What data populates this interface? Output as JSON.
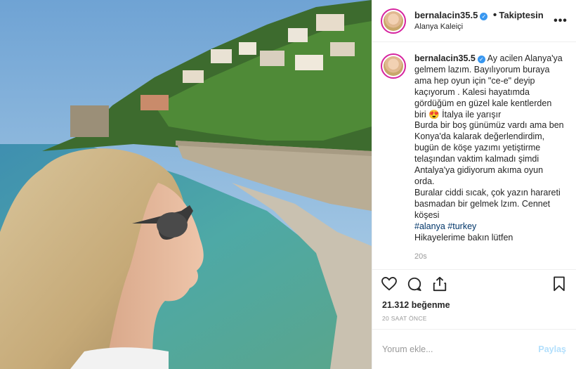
{
  "post": {
    "username": "bernalacin35.5",
    "follow_label": "Takiptesin",
    "dot": "•",
    "location": "Alanya Kaleiçi",
    "more_label": "•••",
    "verified_mark": "✓"
  },
  "caption": {
    "username": "bernalacin35.5",
    "lines": [
      "Ay acilen Alanya'ya",
      "gelmem lazım. Bayılıyorum buraya",
      "ama hep oyun için \"ce-e\" deyip",
      "kaçıyorum . Kalesi hayatımda",
      "gördüğüm en güzel kale kentlerden",
      "biri 😍 İtalya ile yarışır",
      "Burda bir boş günümüz vardı ama ben",
      "Konya'da kalarak değerlendirdim,",
      "bugün de köşe yazımı yetiştirme",
      "telaşından vaktim kalmadı şimdi",
      "Antalya'ya gidiyorum akıma oyun",
      "orda.",
      "Buralar ciddi sıcak, çok yazın harareti",
      "basmadan bir gelmek lzım. Cennet",
      "köşesi"
    ],
    "hashtag1": "#alanya",
    "hashtag2": "#turkey",
    "last_line": "Hikayelerime bakın lütfen",
    "time_ago": "20s"
  },
  "icons": {
    "like": "heart-icon",
    "comment": "comment-icon",
    "share": "share-icon",
    "save": "bookmark-icon"
  },
  "likes_label": "21.312 beğenme",
  "date_label": "20 SAAT ÖNCE",
  "comment_box": {
    "placeholder": "Yorum ekle...",
    "share_label": "Paylaş"
  },
  "colors": {
    "link": "#003569",
    "verified": "#3897f0",
    "share_disabled": "#b2dffc",
    "muted": "#999999"
  }
}
